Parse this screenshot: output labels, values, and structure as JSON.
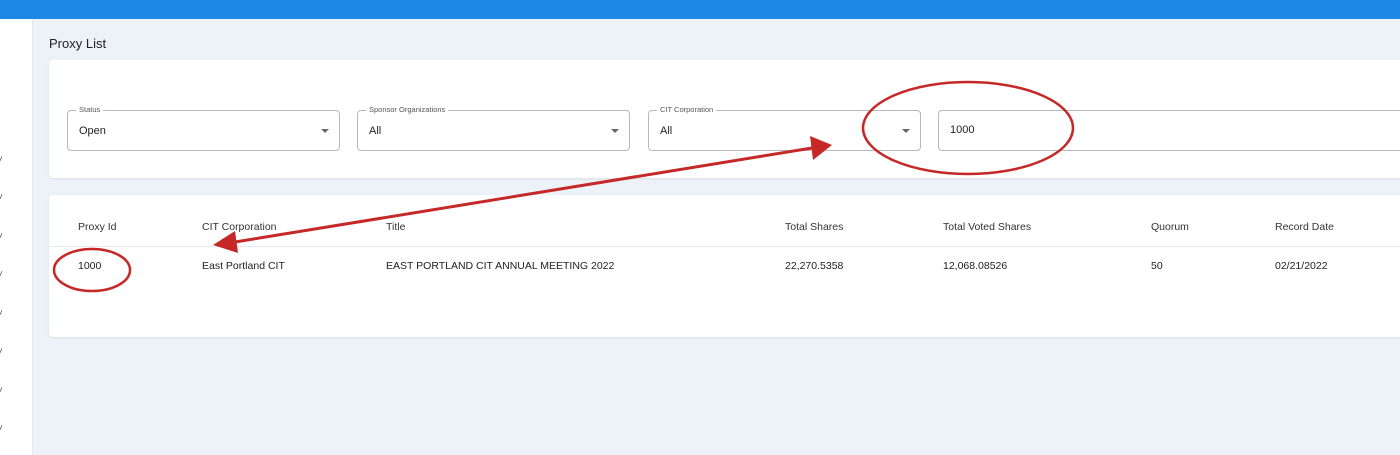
{
  "page": {
    "title": "Proxy List"
  },
  "filters": {
    "status": {
      "label": "Status",
      "value": "Open"
    },
    "sponsor": {
      "label": "Sponsor Organizations",
      "value": "All"
    },
    "corporation": {
      "label": "CIT Corporation",
      "value": "All"
    },
    "search": {
      "value": "1000"
    }
  },
  "table": {
    "columns": [
      "Proxy Id",
      "CIT Corporation",
      "Title",
      "Total Shares",
      "Total Voted Shares",
      "Quorum",
      "Record Date"
    ],
    "rows": [
      [
        "1000",
        "East Portland CIT",
        "EAST PORTLAND CIT ANNUAL MEETING 2022",
        "22,270.5358",
        "12,068.08526",
        "50",
        "02/21/2022"
      ]
    ]
  },
  "annotations": {
    "color": "#c62828"
  },
  "colors": {
    "topbar": "#1e88e5",
    "background": "#ecf2f7"
  }
}
